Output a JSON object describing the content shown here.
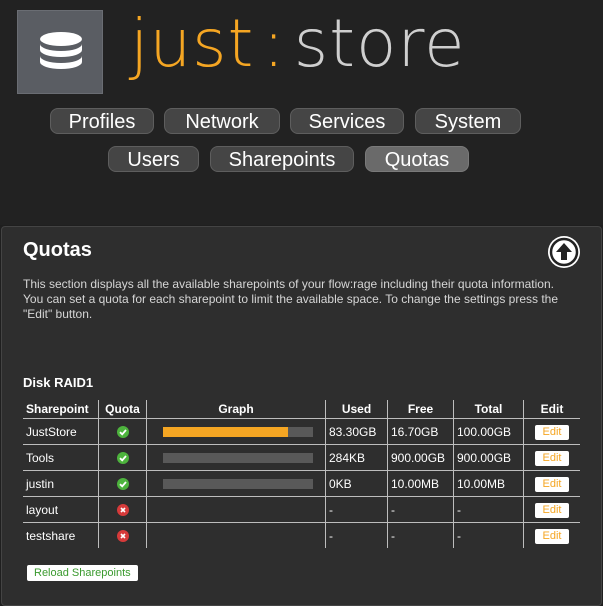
{
  "brand": {
    "part1": "just",
    "sep": ":",
    "part2": "store"
  },
  "nav": {
    "row1": [
      "Profiles",
      "Network",
      "Services",
      "System"
    ],
    "row2": [
      "Users",
      "Sharepoints",
      "Quotas"
    ],
    "active": "Quotas"
  },
  "panel": {
    "title": "Quotas",
    "description": "This section displays all the available sharepoints of your flow:rage including their quota information. You can set a quota for each sharepoint to limit the available space. To change the settings press the \"Edit\" button.",
    "disk_title": "Disk RAID1",
    "headers": [
      "Sharepoint",
      "Quota",
      "Graph",
      "Used",
      "Free",
      "Total",
      "Edit"
    ],
    "rows": [
      {
        "name": "JustStore",
        "quota": "ok",
        "usage_pct": 83,
        "used": "83.30GB",
        "free": "16.70GB",
        "total": "100.00GB",
        "edit": "Edit"
      },
      {
        "name": "Tools",
        "quota": "ok",
        "usage_pct": 0,
        "used": "284KB",
        "free": "900.00GB",
        "total": "900.00GB",
        "edit": "Edit"
      },
      {
        "name": "justin",
        "quota": "ok",
        "usage_pct": 0,
        "used": "0KB",
        "free": "10.00MB",
        "total": "10.00MB",
        "edit": "Edit"
      },
      {
        "name": "layout",
        "quota": "none",
        "usage_pct": null,
        "used": "-",
        "free": "-",
        "total": "-",
        "edit": "Edit"
      },
      {
        "name": "testshare",
        "quota": "none",
        "usage_pct": null,
        "used": "-",
        "free": "-",
        "total": "-",
        "edit": "Edit"
      }
    ],
    "reload_label": "Reload Sharepoints"
  },
  "icons": {
    "logo": "database-icon",
    "up": "arrow-up-circle-icon",
    "ok": "check-circle-icon",
    "none": "x-circle-icon"
  },
  "colors": {
    "accent": "#f5a623",
    "ok": "#4db33d",
    "error": "#d63a3a",
    "bar_bg": "#595959"
  }
}
